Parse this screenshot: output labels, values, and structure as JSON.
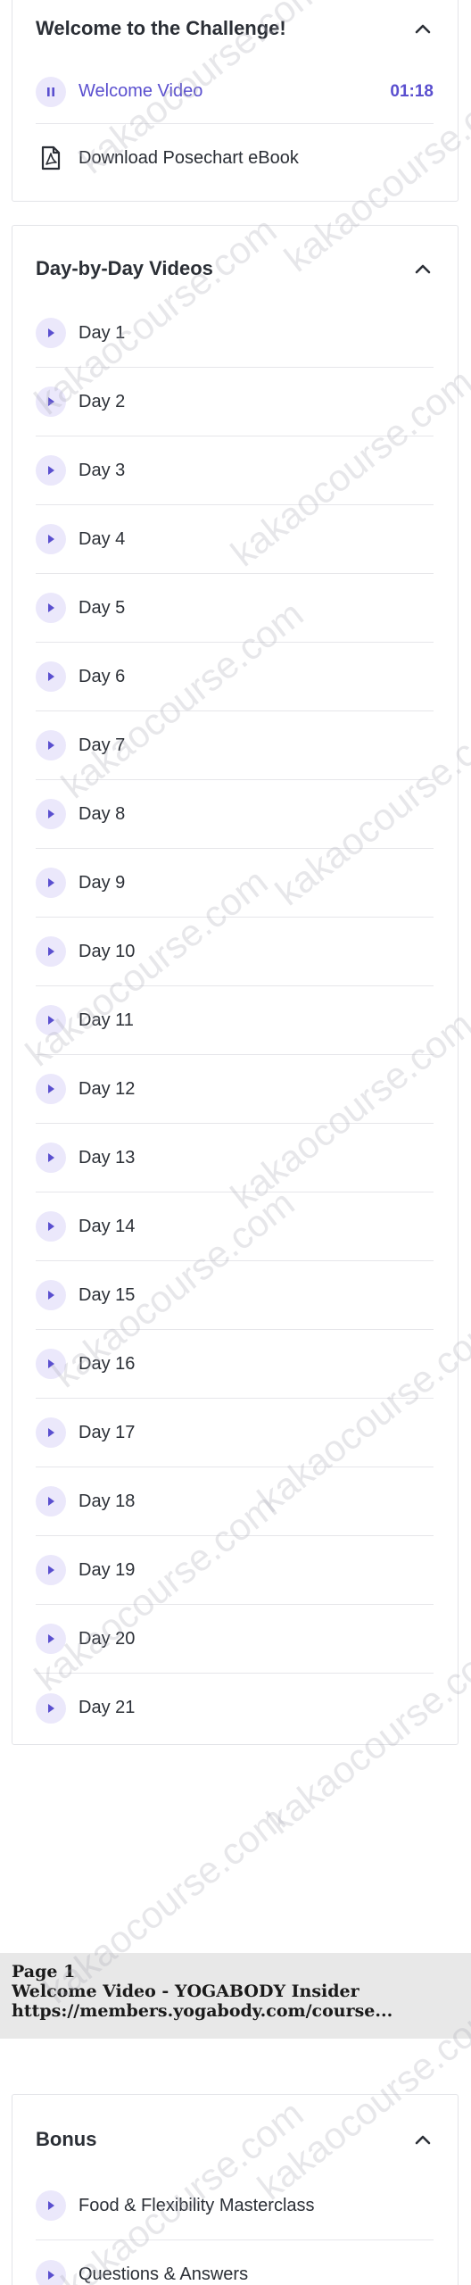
{
  "welcome": {
    "title": "Welcome to the Challenge!",
    "items": [
      {
        "label": "Welcome Video",
        "time": "01:18"
      },
      {
        "label": "Download Posechart eBook"
      }
    ]
  },
  "videos": {
    "title": "Day-by-Day Videos",
    "items": [
      "Day 1",
      "Day 2",
      "Day 3",
      "Day 4",
      "Day 5",
      "Day 6",
      "Day 7",
      "Day 8",
      "Day 9",
      "Day 10",
      "Day 11",
      "Day 12",
      "Day 13",
      "Day 14",
      "Day 15",
      "Day 16",
      "Day 17",
      "Day 18",
      "Day 19",
      "Day 20",
      "Day 21"
    ]
  },
  "print_footer": {
    "page": "Page 1",
    "title": "Welcome Video - YOGABODY Insider",
    "url": "https://members.yogabody.com/course..."
  },
  "bonus": {
    "title": "Bonus",
    "items": [
      "Food & Flexibility Masterclass",
      "Questions & Answers"
    ]
  },
  "watermark": "kakaocourse.com",
  "colors": {
    "accent": "#5a4fcf",
    "play_bg": "#ebe8fb",
    "text": "#2b2f36"
  }
}
